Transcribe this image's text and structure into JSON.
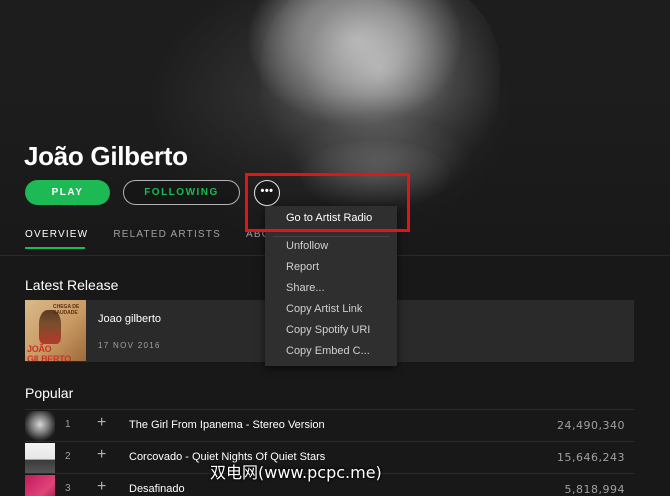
{
  "artist": {
    "name": "João Gilberto",
    "play_label": "PLAY",
    "following_label": "FOLLOWING",
    "more_label": "•••"
  },
  "tabs": [
    "OVERVIEW",
    "RELATED ARTISTS",
    "ABO"
  ],
  "context_menu": {
    "items": [
      "Go to Artist Radio",
      "Unfollow",
      "Report",
      "Share...",
      "Copy Artist Link",
      "Copy Spotify URI",
      "Copy Embed C..."
    ]
  },
  "latest_release": {
    "heading": "Latest Release",
    "title": "Joao gilberto",
    "date": "17 NOV 2016",
    "cover_text": "JOÃO GILBERTO",
    "cover_small_text": "CHEGA DE SAUDADE"
  },
  "popular": {
    "heading": "Popular",
    "tracks": [
      {
        "num": "1",
        "title": "The Girl From Ipanema - Stereo Version",
        "plays": "24,490,340"
      },
      {
        "num": "2",
        "title": "Corcovado - Quiet Nights Of Quiet Stars",
        "plays": "15,646,243"
      },
      {
        "num": "3",
        "title": "Desafinado",
        "plays": "5,818,994"
      }
    ],
    "add_symbol": "+"
  },
  "watermark": "双电网(www.pcpc.me)",
  "colors": {
    "accent": "#1db954",
    "background": "#181818",
    "menu_bg": "#2f2f2f",
    "highlight": "#e01515"
  }
}
